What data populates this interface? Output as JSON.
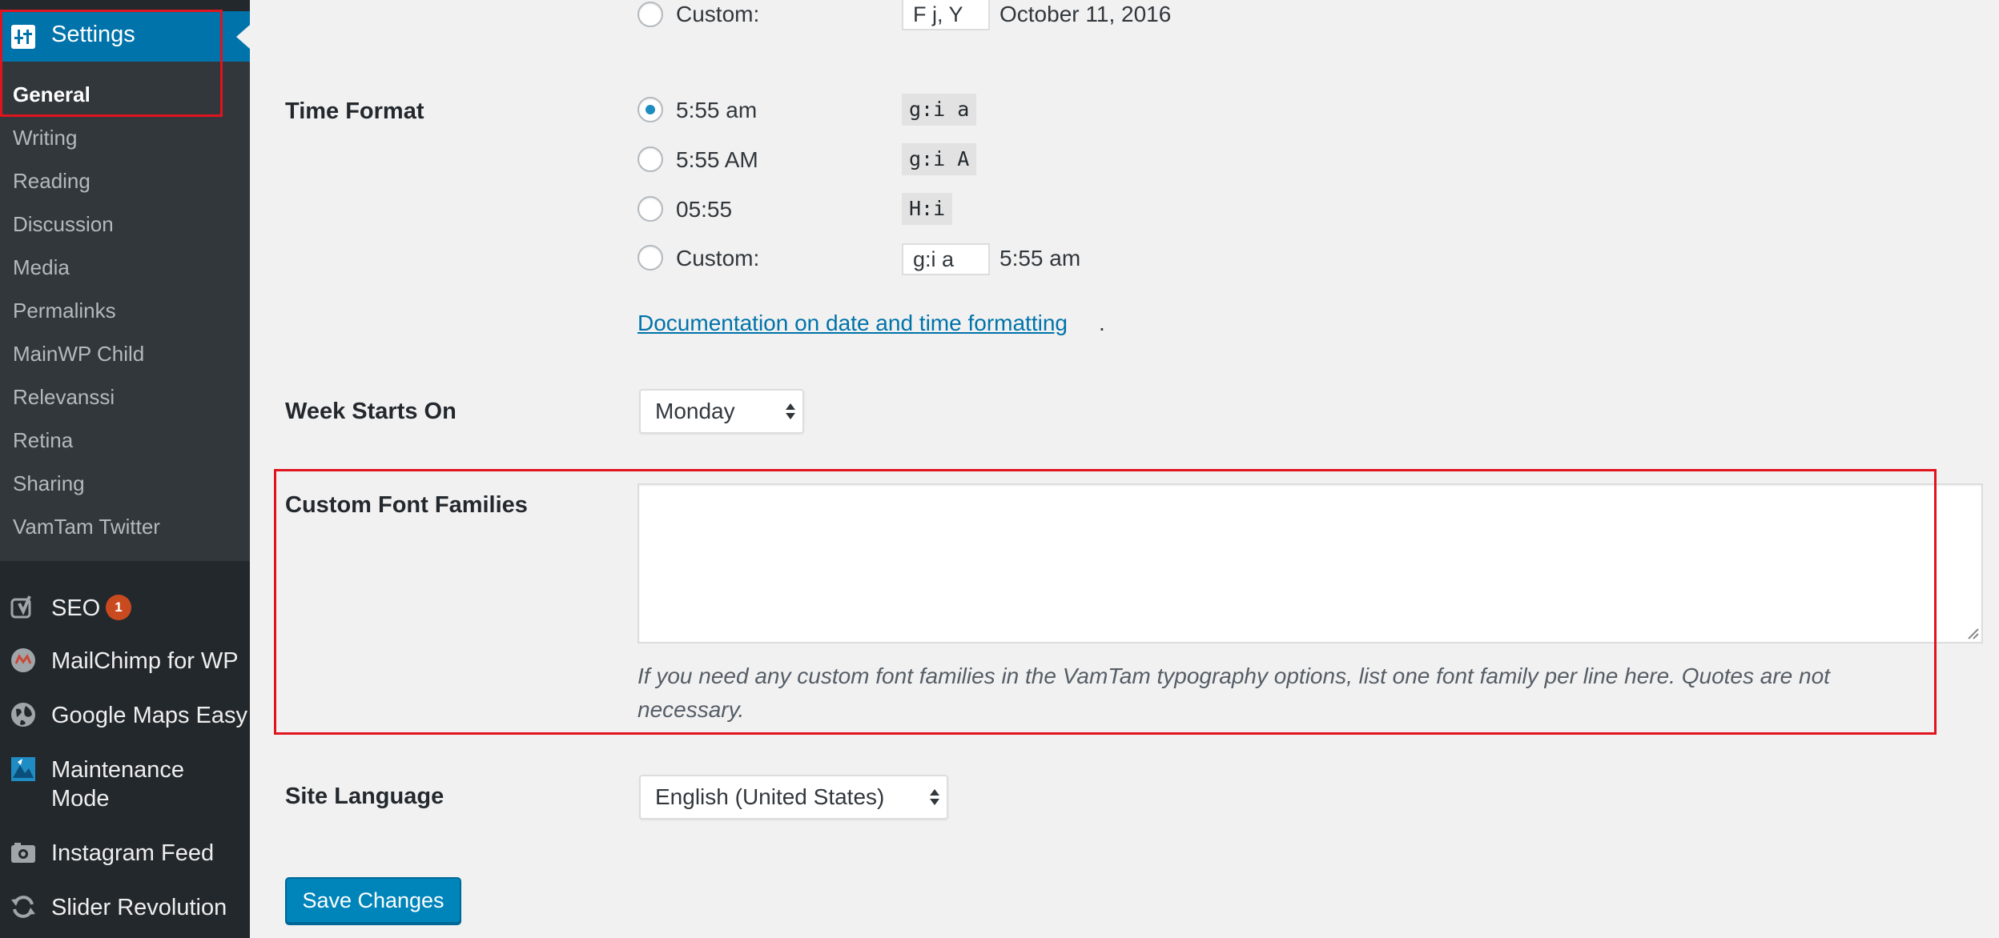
{
  "sidebar": {
    "settings_title": "Settings",
    "submenu": [
      "General",
      "Writing",
      "Reading",
      "Discussion",
      "Media",
      "Permalinks",
      "MainWP Child",
      "Relevanssi",
      "Retina",
      "Sharing",
      "VamTam Twitter"
    ],
    "menu": [
      {
        "label": "SEO",
        "icon": "yoast-icon"
      },
      {
        "label": "MailChimp for WP",
        "icon": "mailchimp-icon"
      },
      {
        "label": "Google Maps Easy",
        "icon": "globe-icon"
      },
      {
        "label": "Maintenance\nMode",
        "icon": "maintenance-icon"
      },
      {
        "label": "Instagram Feed",
        "icon": "camera-icon"
      },
      {
        "label": "Slider Revolution",
        "icon": "refresh-icon"
      }
    ],
    "seo_badge": "1"
  },
  "date_format": {
    "custom_label": "Custom:",
    "custom_value": "F j, Y",
    "custom_preview": "October 11, 2016"
  },
  "time_format": {
    "label": "Time Format",
    "options": [
      {
        "label": "5:55 am",
        "code": "g:i a",
        "checked": true
      },
      {
        "label": "5:55 AM",
        "code": "g:i A",
        "checked": false
      },
      {
        "label": "05:55",
        "code": "H:i",
        "checked": false
      }
    ],
    "custom_label": "Custom:",
    "custom_value": "g:i a",
    "custom_preview": "5:55 am",
    "doc_link": "Documentation on date and time formatting",
    "doc_suffix": "."
  },
  "week_starts": {
    "label": "Week Starts On",
    "value": "Monday"
  },
  "custom_fonts": {
    "label": "Custom Font Families",
    "value": "",
    "description": "If you need any custom font families in the VamTam typography options, list one font family per line here. Quotes are not necessary."
  },
  "site_language": {
    "label": "Site Language",
    "value": "English (United States)"
  },
  "save_button": "Save Changes",
  "colors": {
    "sidebar_bg": "#23282d",
    "submenu_bg": "#32373c",
    "accent": "#0073aa",
    "highlight": "#e0141e",
    "badge": "#ca4a1f"
  }
}
